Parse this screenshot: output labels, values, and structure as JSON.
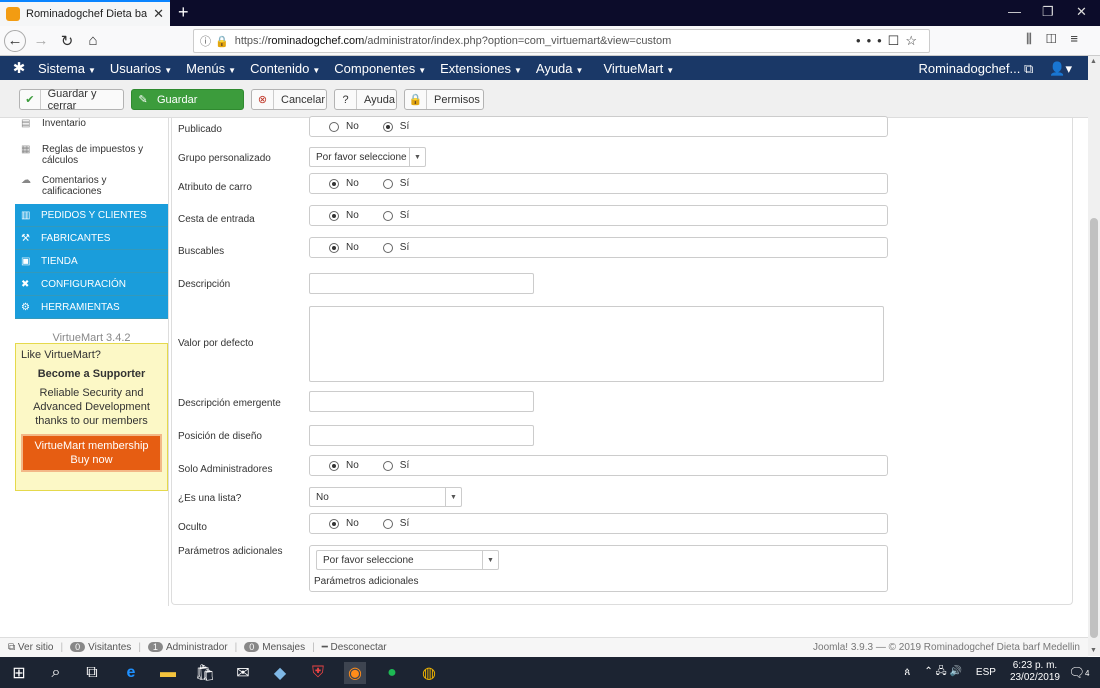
{
  "browser": {
    "tab_title": "Rominadogchef Dieta barf Med",
    "url_domain": "rominadogchef.com",
    "url_prefix": "https://",
    "url_path": "/administrator/index.php?option=com_virtuemart&view=custom"
  },
  "menu": {
    "items": [
      "Sistema",
      "Usuarios",
      "Menús",
      "Contenido",
      "Componentes",
      "Extensiones",
      "Ayuda",
      "VirtueMart"
    ],
    "user": "Rominadogchef..."
  },
  "toolbar": {
    "save_close": "Guardar y cerrar",
    "save": "Guardar",
    "cancel": "Cancelar",
    "help": "Ayuda",
    "permissions": "Permisos"
  },
  "sidebar": {
    "links": [
      {
        "label": "Inventario",
        "icon": "inventory-icon"
      },
      {
        "label": "Reglas de impuestos y cálculos",
        "icon": "tax-icon"
      },
      {
        "label": "Comentarios y calificaciones",
        "icon": "comments-icon"
      }
    ],
    "categories": [
      {
        "label": "PEDIDOS Y CLIENTES",
        "icon": "orders-icon"
      },
      {
        "label": "FABRICANTES",
        "icon": "wrench-icon"
      },
      {
        "label": "TIENDA",
        "icon": "shop-icon"
      },
      {
        "label": "CONFIGURACIÓN",
        "icon": "config-icon"
      },
      {
        "label": "HERRAMIENTAS",
        "icon": "tools-icon"
      }
    ],
    "version": "VirtueMart 3.4.2",
    "promo": {
      "like": "Like VirtueMart?",
      "become": "Become a Supporter",
      "reliable": "Reliable Security and Advanced Development thanks to our members",
      "membership": "VirtueMart membership",
      "buy": "Buy now"
    }
  },
  "form": {
    "publicado": {
      "label": "Publicado",
      "no": "No",
      "si": "Sí",
      "selected": "si"
    },
    "grupo": {
      "label": "Grupo personalizado",
      "value": "Por favor seleccione"
    },
    "atributo": {
      "label": "Atributo de carro",
      "no": "No",
      "si": "Sí",
      "selected": "no"
    },
    "cesta": {
      "label": "Cesta de entrada",
      "no": "No",
      "si": "Sí",
      "selected": "no"
    },
    "buscables": {
      "label": "Buscables",
      "no": "No",
      "si": "Sí",
      "selected": "no"
    },
    "descripcion": {
      "label": "Descripción",
      "value": ""
    },
    "valor": {
      "label": "Valor por defecto",
      "value": ""
    },
    "emergente": {
      "label": "Descripción emergente",
      "value": ""
    },
    "posicion": {
      "label": "Posición de diseño",
      "value": ""
    },
    "solo_admin": {
      "label": "Solo Administradores",
      "no": "No",
      "si": "Sí",
      "selected": "no"
    },
    "es_lista": {
      "label": "¿Es una lista?",
      "value": "No"
    },
    "oculto": {
      "label": "Oculto",
      "no": "No",
      "si": "Sí",
      "selected": "no"
    },
    "parametros": {
      "label": "Parámetros adicionales",
      "value": "Por favor seleccione",
      "sub": "Parámetros adicionales"
    }
  },
  "statusbar": {
    "ver_sitio": "Ver sitio",
    "visitantes_count": "0",
    "visitantes": "Visitantes",
    "admin_count": "1",
    "admin": "Administrador",
    "mensajes_count": "0",
    "mensajes": "Mensajes",
    "desconectar": "Desconectar",
    "footer": "Joomla! 3.9.3 — © 2019 Rominadogchef Dieta barf Medellin"
  },
  "taskbar": {
    "lang": "ESP",
    "time": "6:23 p. m.",
    "date": "23/02/2019",
    "notif_count": "4"
  }
}
